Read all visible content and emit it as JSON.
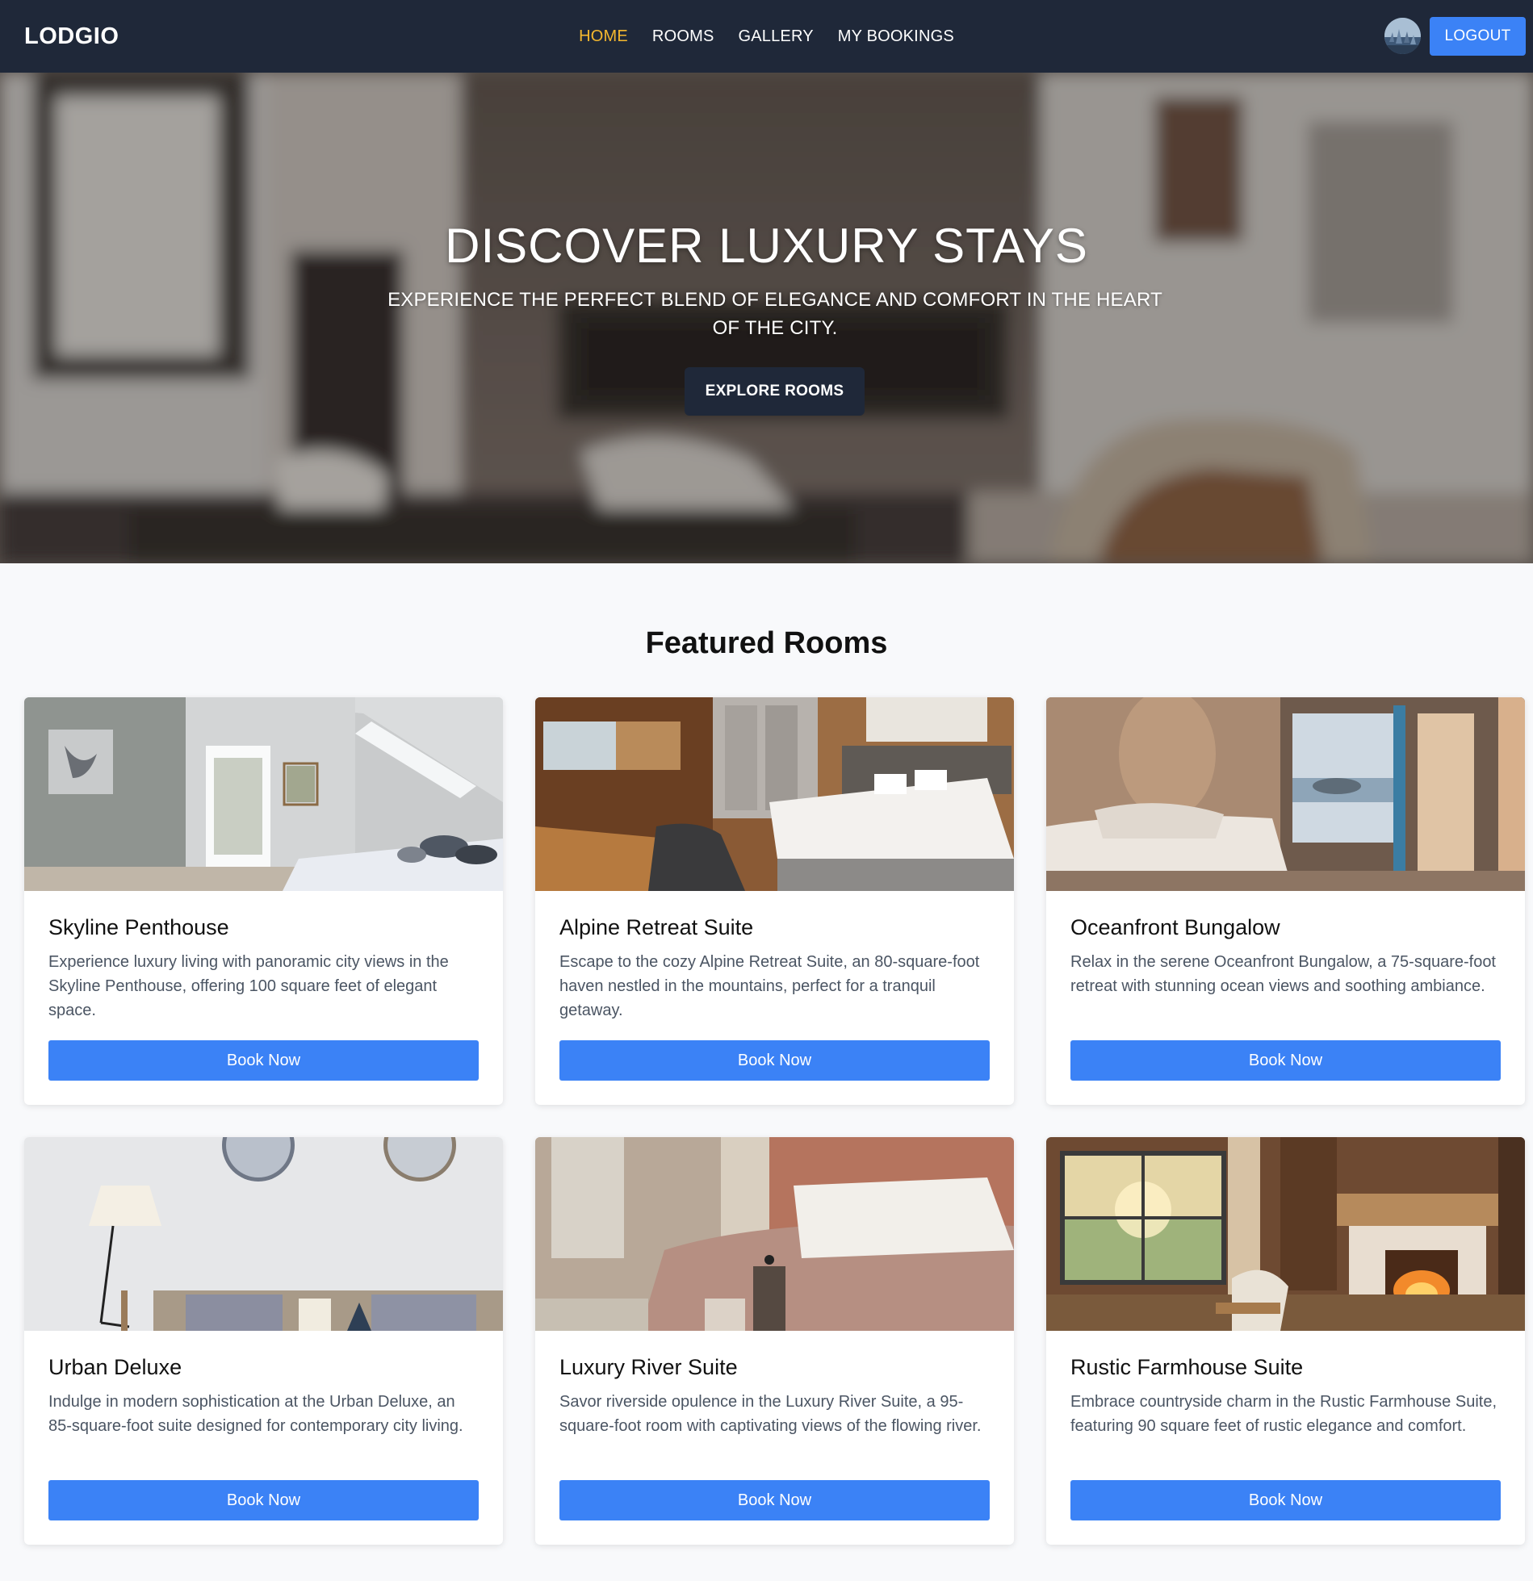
{
  "navbar": {
    "brand": "LODGIO",
    "links": [
      {
        "label": "HOME",
        "active": true
      },
      {
        "label": "ROOMS",
        "active": false
      },
      {
        "label": "GALLERY",
        "active": false
      },
      {
        "label": "MY BOOKINGS",
        "active": false
      }
    ],
    "logout_label": "LOGOUT",
    "avatar_icon": "user-avatar"
  },
  "hero": {
    "title": "DISCOVER LUXURY STAYS",
    "subtitle": "EXPERIENCE THE PERFECT BLEND OF ELEGANCE AND COMFORT IN THE HEART OF THE CITY.",
    "button_label": "EXPLORE ROOMS"
  },
  "featured": {
    "title": "Featured Rooms",
    "rooms": [
      {
        "name": "Skyline Penthouse",
        "description": "Experience luxury living with panoramic city views in the Skyline Penthouse, offering 100 square feet of elegant space.",
        "button_label": "Book Now"
      },
      {
        "name": "Alpine Retreat Suite",
        "description": "Escape to the cozy Alpine Retreat Suite, an 80-square-foot haven nestled in the mountains, perfect for a tranquil getaway.",
        "button_label": "Book Now"
      },
      {
        "name": "Oceanfront Bungalow",
        "description": "Relax in the serene Oceanfront Bungalow, a 75-square-foot retreat with stunning ocean views and soothing ambiance.",
        "button_label": "Book Now"
      },
      {
        "name": "Urban Deluxe",
        "description": "Indulge in modern sophistication at the Urban Deluxe, an 85-square-foot suite designed for contemporary city living.",
        "button_label": "Book Now"
      },
      {
        "name": "Luxury River Suite",
        "description": "Savor riverside opulence in the Luxury River Suite, a 95-square-foot room with captivating views of the flowing river.",
        "button_label": "Book Now"
      },
      {
        "name": "Rustic Farmhouse Suite",
        "description": "Embrace countryside charm in the Rustic Farmhouse Suite, featuring 90 square feet of rustic elegance and comfort.",
        "button_label": "Book Now"
      }
    ]
  },
  "colors": {
    "navbar_bg": "#1f2839",
    "active_link": "#f5b82e",
    "primary_button": "#3b82f6",
    "page_bg": "#f8f9fb"
  }
}
